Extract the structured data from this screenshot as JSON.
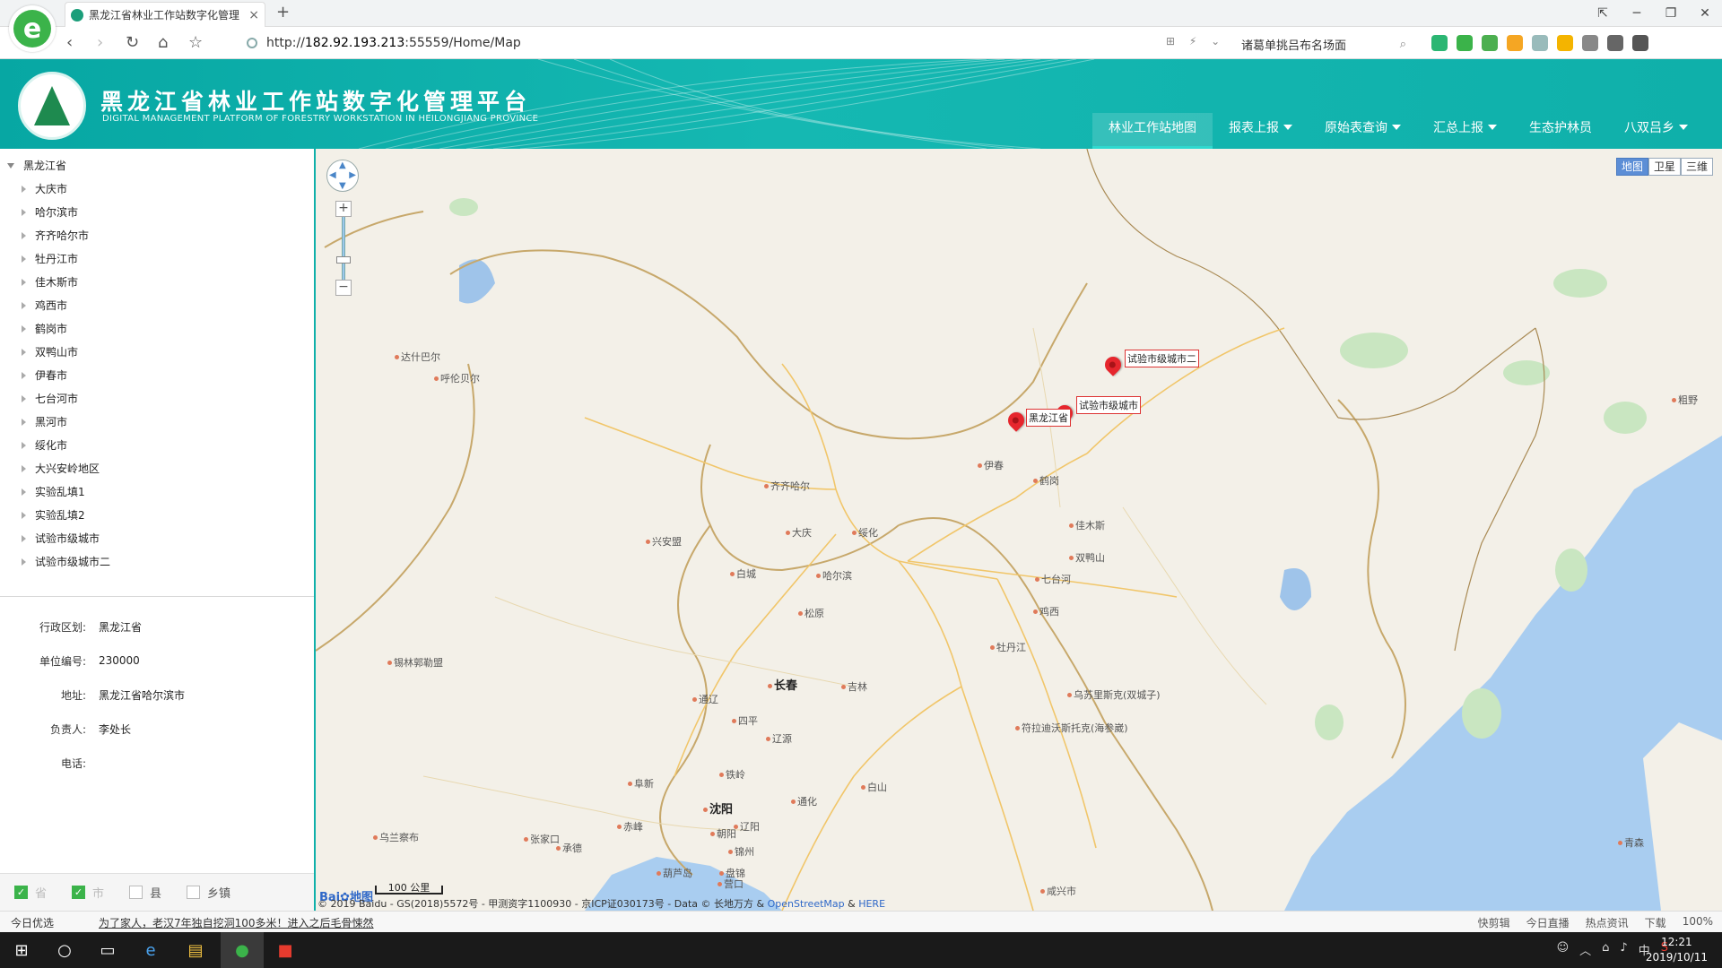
{
  "browser": {
    "tab_title": "黑龙江省林业工作站数字化管理",
    "url_prefix": "http://",
    "url_host": "182.92.193.213",
    "url_path": ":55559/Home/Map",
    "search_text": "诸葛单挑吕布名场面",
    "new_tab": "+",
    "tab_close": "×"
  },
  "app": {
    "title": "黑龙江省林业工作站数字化管理平台",
    "subtitle": "DIGITAL MANAGEMENT PLATFORM OF FORESTRY WORKSTATION IN HEILONGJIANG PROVINCE",
    "nav": [
      {
        "label": "林业工作站地图",
        "dropdown": false,
        "active": true
      },
      {
        "label": "报表上报",
        "dropdown": true,
        "active": false
      },
      {
        "label": "原始表查询",
        "dropdown": true,
        "active": false
      },
      {
        "label": "汇总上报",
        "dropdown": true,
        "active": false
      },
      {
        "label": "生态护林员",
        "dropdown": false,
        "active": false
      },
      {
        "label": "八双吕乡",
        "dropdown": true,
        "active": false
      }
    ]
  },
  "tree": {
    "root": "黑龙江省",
    "children": [
      "大庆市",
      "哈尔滨市",
      "齐齐哈尔市",
      "牡丹江市",
      "佳木斯市",
      "鸡西市",
      "鹤岗市",
      "双鸭山市",
      "伊春市",
      "七台河市",
      "黑河市",
      "绥化市",
      "大兴安岭地区",
      "实验乱填1",
      "实验乱填2",
      "试验市级城市",
      "试验市级城市二"
    ]
  },
  "info": [
    {
      "label": "行政区划:",
      "value": "黑龙江省"
    },
    {
      "label": "单位编号:",
      "value": "230000"
    },
    {
      "label": "地址:",
      "value": "黑龙江省哈尔滨市"
    },
    {
      "label": "负责人:",
      "value": "李处长"
    },
    {
      "label": "电话:",
      "value": ""
    }
  ],
  "legend": [
    {
      "label": "省",
      "checked": true,
      "dim": true
    },
    {
      "label": "市",
      "checked": true,
      "dim": true
    },
    {
      "label": "县",
      "checked": false,
      "dim": false
    },
    {
      "label": "乡镇",
      "checked": false,
      "dim": false
    }
  ],
  "map": {
    "types": [
      {
        "label": "地图",
        "active": true
      },
      {
        "label": "卫星",
        "active": false
      },
      {
        "label": "三维",
        "active": false
      }
    ],
    "markers": [
      {
        "label": "试验市级城市二"
      },
      {
        "label": "试验市级城市"
      },
      {
        "label": "黑龙江省"
      }
    ],
    "cities": [
      "伊春",
      "鹤岗",
      "佳木斯",
      "双鸭山",
      "七台河",
      "鸡西",
      "牡丹江",
      "齐齐哈尔",
      "大庆",
      "绥化",
      "哈尔滨",
      "松原",
      "白城",
      "兴安盟",
      "长春",
      "吉林",
      "通辽",
      "四平",
      "辽源",
      "铁岭",
      "白山",
      "通化",
      "沈阳",
      "辽阳",
      "阜新",
      "朝阳",
      "锦州",
      "盘锦",
      "营口",
      "葫芦岛",
      "赤峰",
      "承德",
      "张家口",
      "乌兰察布",
      "呼伦贝尔",
      "达什巴尔",
      "锡林郭勒盟",
      "符拉迪沃斯托克(海参崴)",
      "乌苏里斯克(双城子)",
      "咸兴市",
      "青森",
      "粗野"
    ],
    "zoom_in": "+",
    "zoom_out": "−",
    "scale_label": "100 公里",
    "copyright_main": "© 2019 Baidu - GS(2018)5572号 - 甲测资字1100930 - 京ICP证030173号 - Data © 长地万方 & ",
    "copyright_osm": "OpenStreetMap",
    "copyright_amp": " & ",
    "copyright_here": "HERE",
    "baidu_logo": "Bai",
    "baidu_logo2": "地图"
  },
  "statusbar": {
    "today": "今日优选",
    "news": "为了家人，老汉7年独自挖洞100多米！进入之后毛骨悚然",
    "right": [
      "快剪辑",
      "今日直播",
      "热点资讯",
      "下载",
      "100%"
    ]
  },
  "taskbar": {
    "time": "12:21",
    "date": "2019/10/11",
    "ime": "中"
  },
  "colors": {
    "brand": "#0fb0aa",
    "marker": "#e6262d"
  }
}
